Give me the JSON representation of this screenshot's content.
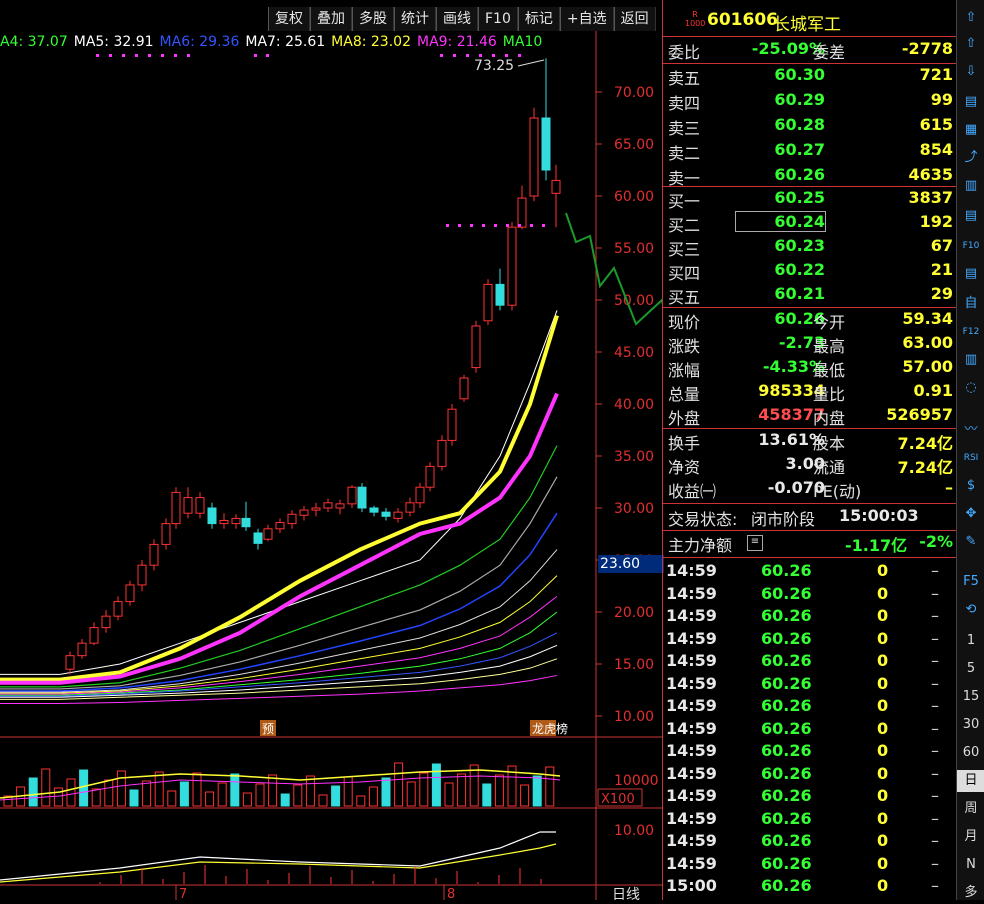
{
  "toolbar": [
    "复权",
    "叠加",
    "多股",
    "统计",
    "画线",
    "F10",
    "标记",
    "+自选",
    "返回"
  ],
  "ma_legend": [
    {
      "label": "A4: 37.07",
      "color": "#33ff33"
    },
    {
      "label": "MA5: 32.91",
      "color": "#ffffff"
    },
    {
      "label": "MA6: 29.36",
      "color": "#3355ff"
    },
    {
      "label": "MA7: 25.61",
      "color": "#ffffff"
    },
    {
      "label": "MA8: 23.02",
      "color": "#ffff33"
    },
    {
      "label": "MA9: 21.46",
      "color": "#ff33ff"
    },
    {
      "label": "MA10",
      "color": "#33ff33"
    }
  ],
  "chart": {
    "peak_label": "73.25",
    "y_ticks": [
      "70.00",
      "65.00",
      "60.00",
      "55.00",
      "50.00",
      "45.00",
      "40.00",
      "35.00",
      "30.00",
      "25.00",
      "20.00",
      "15.00",
      "10.00"
    ],
    "price_tag": "23.60",
    "vol_tick": "10000",
    "vol_unit": "X100",
    "ind_tick": "10.00",
    "x_labels": [
      "7",
      "8"
    ],
    "period": "日线",
    "marks": [
      "预",
      "龙虎榜"
    ]
  },
  "stock": {
    "badge": "R 1000",
    "code": "601606",
    "name": "长城军工"
  },
  "order_ratio": {
    "label": "委比",
    "value": "-25.09%",
    "label2": "委差",
    "value2": "-2778"
  },
  "sell": [
    {
      "label": "卖五",
      "price": "60.30",
      "vol": "721"
    },
    {
      "label": "卖四",
      "price": "60.29",
      "vol": "99"
    },
    {
      "label": "卖三",
      "price": "60.28",
      "vol": "615"
    },
    {
      "label": "卖二",
      "price": "60.27",
      "vol": "854"
    },
    {
      "label": "卖一",
      "price": "60.26",
      "vol": "4635"
    }
  ],
  "buy": [
    {
      "label": "买一",
      "price": "60.25",
      "vol": "3837"
    },
    {
      "label": "买二",
      "price": "60.24",
      "vol": "192"
    },
    {
      "label": "买三",
      "price": "60.23",
      "vol": "67"
    },
    {
      "label": "买四",
      "price": "60.22",
      "vol": "21"
    },
    {
      "label": "买五",
      "price": "60.21",
      "vol": "29"
    }
  ],
  "quote": [
    {
      "l1": "现价",
      "v1": "60.26",
      "c1": "g",
      "l2": "今开",
      "v2": "59.34",
      "c2": "g"
    },
    {
      "l1": "涨跌",
      "v1": "-2.73",
      "c1": "g",
      "l2": "最高",
      "v2": "63.00",
      "c2": "r"
    },
    {
      "l1": "涨幅",
      "v1": "-4.33%",
      "c1": "g",
      "l2": "最低",
      "v2": "57.00",
      "c2": "g"
    },
    {
      "l1": "总量",
      "v1": "985334",
      "c1": "y",
      "l2": "量比",
      "v2": "0.91",
      "c2": "y"
    },
    {
      "l1": "外盘",
      "v1": "458377",
      "c1": "r",
      "l2": "内盘",
      "v2": "526957",
      "c2": "g"
    }
  ],
  "fund": [
    {
      "l1": "换手",
      "v1": "13.61%",
      "l2": "股本",
      "v2": "7.24亿"
    },
    {
      "l1": "净资",
      "v1": "3.00",
      "l2": "流通",
      "v2": "7.24亿"
    },
    {
      "l1": "收益㈠",
      "v1": "-0.070",
      "l2": "PE(动)",
      "v2": "–"
    }
  ],
  "status": {
    "label": "交易状态:",
    "value": "闭市阶段",
    "time": "15:00:03"
  },
  "mainflow": {
    "label": "主力净额",
    "value": "-1.17亿",
    "pct": "-2%"
  },
  "ticks": [
    {
      "t": "14:59",
      "p": "60.26",
      "v": "0",
      "d": "–"
    },
    {
      "t": "14:59",
      "p": "60.26",
      "v": "0",
      "d": "–"
    },
    {
      "t": "14:59",
      "p": "60.26",
      "v": "0",
      "d": "–"
    },
    {
      "t": "14:59",
      "p": "60.26",
      "v": "0",
      "d": "–"
    },
    {
      "t": "14:59",
      "p": "60.26",
      "v": "0",
      "d": "–"
    },
    {
      "t": "14:59",
      "p": "60.26",
      "v": "0",
      "d": "–"
    },
    {
      "t": "14:59",
      "p": "60.26",
      "v": "0",
      "d": "–"
    },
    {
      "t": "14:59",
      "p": "60.26",
      "v": "0",
      "d": "–"
    },
    {
      "t": "14:59",
      "p": "60.26",
      "v": "0",
      "d": "–"
    },
    {
      "t": "14:59",
      "p": "60.26",
      "v": "0",
      "d": "–"
    },
    {
      "t": "14:59",
      "p": "60.26",
      "v": "0",
      "d": "–"
    },
    {
      "t": "14:59",
      "p": "60.26",
      "v": "0",
      "d": "–"
    },
    {
      "t": "14:59",
      "p": "60.26",
      "v": "0",
      "d": "–"
    },
    {
      "t": "14:59",
      "p": "60.26",
      "v": "0",
      "d": "–"
    },
    {
      "t": "15:00",
      "p": "60.26",
      "v": "0",
      "d": "–"
    }
  ],
  "side_icons": [
    "⇧",
    "⇧",
    "⇩",
    "▤",
    "▦",
    "⤴",
    "▥",
    "▤",
    "F10",
    "▤",
    "自",
    "F12",
    "▥",
    "◌",
    "〰",
    "RSI",
    "$",
    "✥",
    "✎",
    "F5",
    "⟲"
  ],
  "periods": [
    "1",
    "5",
    "15",
    "30",
    "60",
    "日",
    "周",
    "月",
    "N",
    "多"
  ]
}
